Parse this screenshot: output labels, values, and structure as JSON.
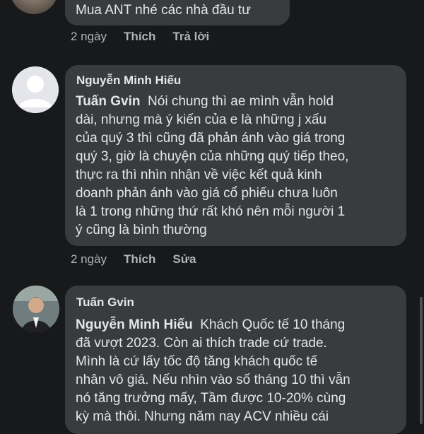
{
  "comments": [
    {
      "text": "Mua ANT nhé các nhà đầu tư",
      "time": "2 ngày",
      "actions": [
        "Thích",
        "Trả lời"
      ]
    },
    {
      "author": "Nguyễn Minh Hiếu",
      "mention": "Tuấn Gvin",
      "lines": [
        "Nói chung thì ae mình vẫn hold",
        "dài, nhưng mà ý kiến của e là những j xấu",
        "của quý 3 thì cũng đã phản ánh vào giá trong",
        "quý 3, giờ là chuyện của những quý tiếp theo,",
        "thực ra thì nhìn nhận về việc kết quả kinh",
        "doanh phản ánh vào giá cổ phiếu chưa luôn",
        "là 1 trong những thứ rất khó nên mỗi người 1",
        "ý cũng là bình thường"
      ],
      "time": "2 ngày",
      "actions": [
        "Thích",
        "Sửa"
      ]
    },
    {
      "author": "Tuấn Gvin",
      "mention": "Nguyễn Minh Hiếu",
      "lines": [
        "Khách Quốc tế 10 tháng",
        "đã vượt 2023. Còn ai thích trade cứ trade.",
        "Mình là cứ lấy tốc độ tăng khách quốc tế",
        "nhân vô giá. Nếu nhìn vào số tháng 10 thì vẫn",
        "nó tăng trưởng mấy, Tầm được 10-20% cùng",
        "kỳ mà thôi. Nhưng năm nay ACV nhiều cái"
      ]
    }
  ]
}
